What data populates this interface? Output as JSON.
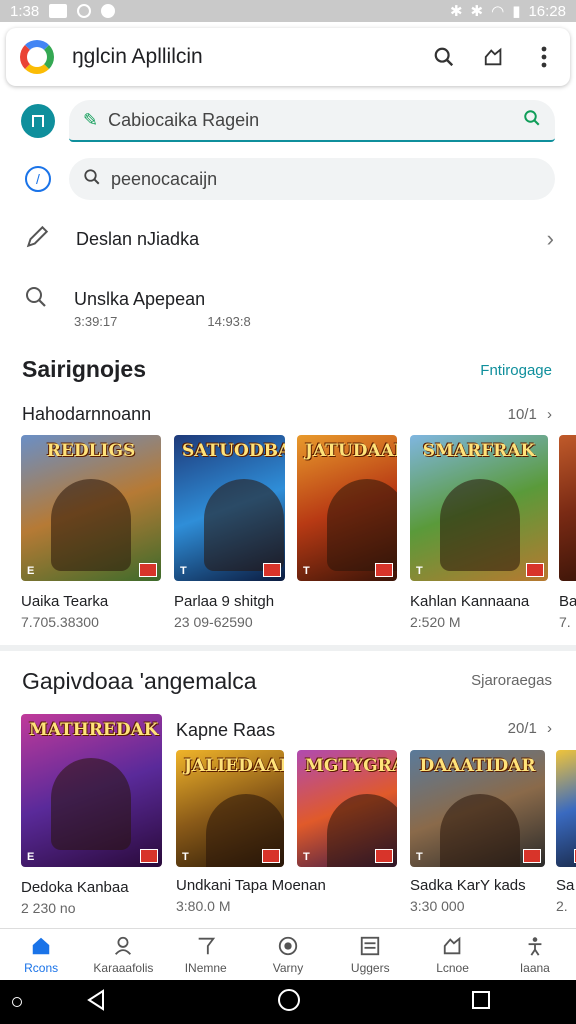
{
  "status_bar": {
    "time_left": "1:38",
    "time_right": "16:28"
  },
  "app_bar": {
    "title": "ŋglcin Apllilcin"
  },
  "search_primary": {
    "text": "Cabiocaika Ragein"
  },
  "search_secondary": {
    "text": "peenocacaijn"
  },
  "list": [
    {
      "label": "Deslan nJiadka"
    },
    {
      "label": "Unslka Apepean",
      "sub1": "3:39:17",
      "sub2": "14:93:8"
    }
  ],
  "section1": {
    "title": "Sairignojes",
    "link": "Fntirogage",
    "subtitle": "Hahodarnnoann",
    "count": "10/1",
    "cards": [
      {
        "image_title": "REDLIGS",
        "name": "Uaika Tearka",
        "sub": "7.705.38300",
        "rating": "E",
        "colors": [
          "#6a8fc6",
          "#b67a35",
          "#3d6b2b"
        ]
      },
      {
        "image_title": "SATUODBAR",
        "name": "Parlaa 9 shitgh",
        "sub": "23 09-62590",
        "rating": "T",
        "colors": [
          "#1e3a7a",
          "#2f8ed8",
          "#0b1b3f"
        ]
      },
      {
        "image_title": "JATUDAARS",
        "name": "",
        "sub": "",
        "rating": "T",
        "colors": [
          "#e89a2c",
          "#b83a14",
          "#3a1408"
        ]
      },
      {
        "image_title": "SMARFRAK",
        "name": "Kahlan Kannaana",
        "sub": "2:520 M",
        "rating": "T",
        "colors": [
          "#7fb6e0",
          "#5a9a3a",
          "#b77930"
        ]
      },
      {
        "image_title": "",
        "name": "Ba",
        "sub": "7.",
        "rating": "",
        "colors": [
          "#c05a2a",
          "#7a2a14",
          "#3a1408"
        ]
      }
    ]
  },
  "section2": {
    "title": "Gapivdoaa 'angemalca",
    "link": "Sjaroraegas",
    "subtitle": "Kapne Raas",
    "count": "20/1",
    "cards": [
      {
        "image_title": "MATHREDAK",
        "name": "Dedoka Kanbaa",
        "sub": "2 230 no",
        "rating": "E",
        "colors": [
          "#c03a9a",
          "#5a2a9a",
          "#2a0a3a"
        ]
      },
      {
        "image_title": "JALIEDAAR",
        "name": "Undkani Tapa Moenan",
        "sub": "3:80.0 M",
        "rating": "T",
        "colors": [
          "#f0b42a",
          "#8a5a18",
          "#2a1a08"
        ]
      },
      {
        "image_title": "MGTYGRAS",
        "name": "",
        "sub": "",
        "rating": "T",
        "colors": [
          "#b04ab0",
          "#e05a2a",
          "#3a1a4a"
        ]
      },
      {
        "image_title": "DAAATIDAR",
        "name": "Sadka KarY kads",
        "sub": "3:30 000",
        "rating": "T",
        "colors": [
          "#5a7a9a",
          "#8a6a4a",
          "#2a2a2a"
        ]
      },
      {
        "image_title": "",
        "name": "Sa",
        "sub": "2.",
        "rating": "",
        "colors": [
          "#f0c43a",
          "#3a6ac0",
          "#1a2a4a"
        ]
      }
    ]
  },
  "bottom_nav": [
    {
      "label": "Rcons",
      "icon": "home-icon",
      "active": true
    },
    {
      "label": "Karaaafolis",
      "icon": "person-icon",
      "active": false
    },
    {
      "label": "INemne",
      "icon": "tag-icon",
      "active": false
    },
    {
      "label": "Varny",
      "icon": "badge-icon",
      "active": false
    },
    {
      "label": "Uggers",
      "icon": "list-icon",
      "active": false
    },
    {
      "label": "Lcnoe",
      "icon": "share-icon",
      "active": false
    },
    {
      "label": "Iaana",
      "icon": "accessibility-icon",
      "active": false
    }
  ],
  "colors": {
    "accent": "#0f8f9c",
    "active_nav": "#1a73e8"
  }
}
